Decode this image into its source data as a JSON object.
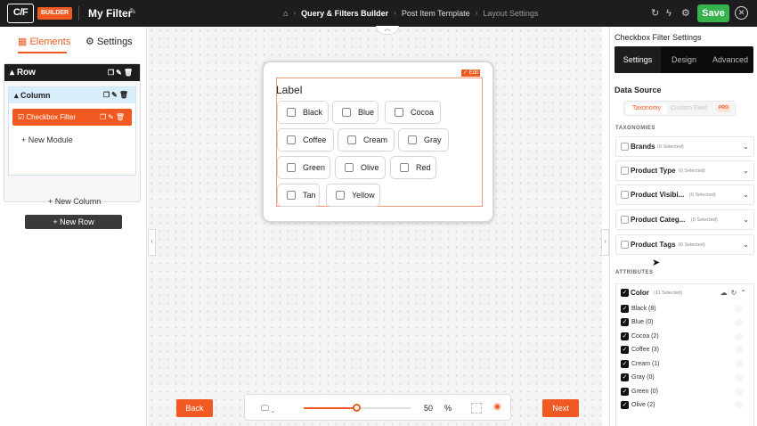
{
  "topbar": {
    "logo": "C/F",
    "builder_badge": "BUILDER",
    "filter_title": "My Filter",
    "breadcrumbs": [
      "Query & Filters Builder",
      "Post Item Template",
      "Layout Settings"
    ],
    "save_label": "Save"
  },
  "left_panel": {
    "tabs": [
      "Elements",
      "Settings"
    ],
    "row_label": "Row",
    "column_label": "Column",
    "module_label": "Checkbox Filter",
    "new_module": "New Module",
    "new_column": "New Column",
    "new_row": "New Row"
  },
  "canvas": {
    "edit_badge": "Edit",
    "filter_label": "Label",
    "options": [
      "Black",
      "Blue",
      "Cocoa",
      "Coffee",
      "Cream",
      "Gray",
      "Green",
      "Olive",
      "Red",
      "Tan",
      "Yellow"
    ],
    "zoom_value": "50",
    "zoom_unit": "%",
    "zoom_fraction": 0.5,
    "back_label": "Back",
    "next_label": "Next"
  },
  "right_panel": {
    "title": "Checkbox Filter Settings",
    "tabs": [
      "Settings",
      "Design",
      "Advanced"
    ],
    "active_tab": "Settings",
    "data_source_label": "Data Source",
    "source_options": [
      "Taxonomy",
      "Custom Field"
    ],
    "pro_badge": "PRO",
    "taxonomies_label": "TAXONOMIES",
    "taxonomies": [
      {
        "name": "Brands",
        "count": "(0 Selected)"
      },
      {
        "name": "Product Type",
        "count": "(0 Selected)"
      },
      {
        "name": "Product Visibi...",
        "count": "(0 Selected)"
      },
      {
        "name": "Product Categ...",
        "count": "(0 Selected)"
      },
      {
        "name": "Product Tags",
        "count": "(0 Selected)"
      }
    ],
    "attributes_label": "ATTRIBUTES",
    "color_attribute": {
      "name": "Color",
      "count": "(11 Selected)"
    },
    "color_terms": [
      "Black (8)",
      "Blue (0)",
      "Cocoa (2)",
      "Coffee (3)",
      "Cream (1)",
      "Gray (0)",
      "Green (0)",
      "Olive (2)"
    ]
  },
  "colors": {
    "accent": "#f05a22",
    "save": "#37b24d",
    "dark": "#1d1d1f"
  }
}
